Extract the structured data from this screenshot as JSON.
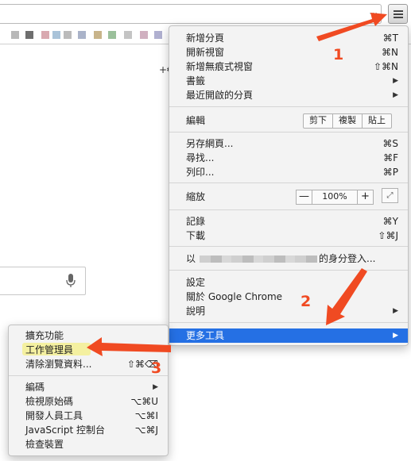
{
  "browser": {
    "omnibox_trailing": "⋯",
    "page_fragment": "+€"
  },
  "menu": {
    "new_tab": {
      "label": "新增分頁",
      "shortcut": "⌘T"
    },
    "new_window": {
      "label": "開新視窗",
      "shortcut": "⌘N"
    },
    "new_incognito": {
      "label": "新增無痕式視窗",
      "shortcut": "⇧⌘N"
    },
    "bookmarks": {
      "label": "書籤"
    },
    "recent_tabs": {
      "label": "最近開啟的分頁"
    },
    "edit": {
      "label": "編輯",
      "cut": "剪下",
      "copy": "複製",
      "paste": "貼上"
    },
    "save_page": {
      "label": "另存網頁...",
      "shortcut": "⌘S"
    },
    "find": {
      "label": "尋找...",
      "shortcut": "⌘F"
    },
    "print": {
      "label": "列印...",
      "shortcut": "⌘P"
    },
    "zoom": {
      "label": "縮放",
      "minus": "—",
      "value": "100%",
      "plus": "+",
      "fullscreen": "⤢"
    },
    "history": {
      "label": "記錄",
      "shortcut": "⌘Y"
    },
    "downloads": {
      "label": "下載",
      "shortcut": "⇧⌘J"
    },
    "signin": {
      "prefix": "以",
      "suffix": "的身分登入..."
    },
    "settings": {
      "label": "設定"
    },
    "about": {
      "label": "關於 Google Chrome"
    },
    "help": {
      "label": "說明"
    },
    "more_tools": {
      "label": "更多工具"
    }
  },
  "submenu": {
    "extensions": {
      "label": "擴充功能"
    },
    "task_manager": {
      "label": "工作管理員"
    },
    "clear_data": {
      "label": "清除瀏覽資料...",
      "shortcut": "⇧⌘⌫"
    },
    "encoding": {
      "label": "編碼"
    },
    "view_source": {
      "label": "檢視原始碼",
      "shortcut": "⌥⌘U"
    },
    "dev_tools": {
      "label": "開發人員工具",
      "shortcut": "⌥⌘I"
    },
    "js_console": {
      "label": "JavaScript 控制台",
      "shortcut": "⌥⌘J"
    },
    "inspect_devices": {
      "label": "檢查裝置"
    }
  },
  "annotations": {
    "step1": "1",
    "step2": "2",
    "step3": "3"
  },
  "colors": {
    "highlight": "#2570e4",
    "arrow": "#f04a22",
    "marker": "#f4f0a0"
  }
}
